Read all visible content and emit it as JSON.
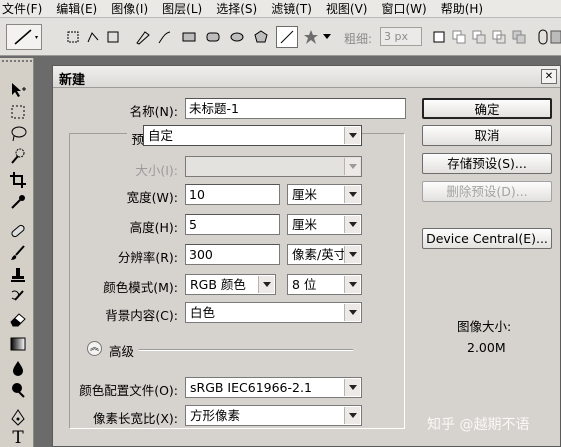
{
  "menubar": [
    "文件(F)",
    "编辑(E)",
    "图像(I)",
    "图层(L)",
    "选择(S)",
    "滤镜(T)",
    "视图(V)",
    "窗口(W)",
    "帮助(H)"
  ],
  "options": {
    "feather_label": "粗细:",
    "feather_value": "3 px"
  },
  "dialog": {
    "title": "新建",
    "close_glyph": "✕",
    "name_label": "名称(N):",
    "name_value": "未标题-1",
    "preset_label": "预设(P):",
    "preset_value": "自定",
    "size_label": "大小(I):",
    "width_label": "宽度(W):",
    "width_value": "10",
    "width_unit": "厘米",
    "height_label": "高度(H):",
    "height_value": "5",
    "height_unit": "厘米",
    "resolution_label": "分辨率(R):",
    "resolution_value": "300",
    "resolution_unit": "像素/英寸",
    "color_mode_label": "颜色模式(M):",
    "color_mode_value": "RGB 颜色",
    "bit_depth": "8 位",
    "bg_label": "背景内容(C):",
    "bg_value": "白色",
    "advanced_label": "高级",
    "profile_label": "颜色配置文件(O):",
    "profile_value": "sRGB IEC61966-2.1",
    "aspect_label": "像素长宽比(X):",
    "aspect_value": "方形像素",
    "ok": "确定",
    "cancel": "取消",
    "save_preset": "存储预设(S)...",
    "delete_preset": "删除预设(D)...",
    "device_central": "Device Central(E)...",
    "image_size_label": "图像大小:",
    "image_size_value": "2.00M"
  },
  "watermark": "知乎 @越期不语"
}
